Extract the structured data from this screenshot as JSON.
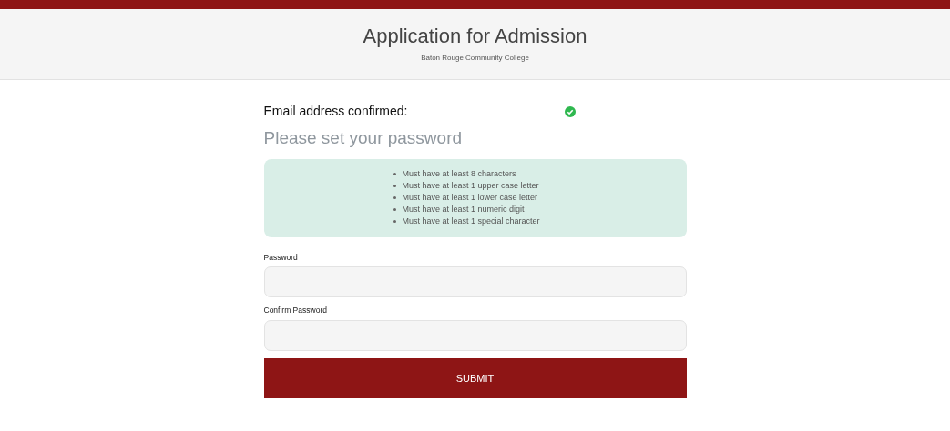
{
  "header": {
    "title": "Application for Admission",
    "subtitle": "Baton Rouge Community College"
  },
  "confirmation": {
    "label": "Email address confirmed:",
    "confirmed": true
  },
  "heading": "Please set your password",
  "requirements": [
    "Must have at least 8 characters",
    "Must have at least 1 upper case letter",
    "Must have at least 1 lower case letter",
    "Must have at least 1 numeric digit",
    "Must have at least 1 special character"
  ],
  "fields": [
    {
      "label": "Password"
    },
    {
      "label": "Confirm Password"
    }
  ],
  "submit": "SUBMIT"
}
